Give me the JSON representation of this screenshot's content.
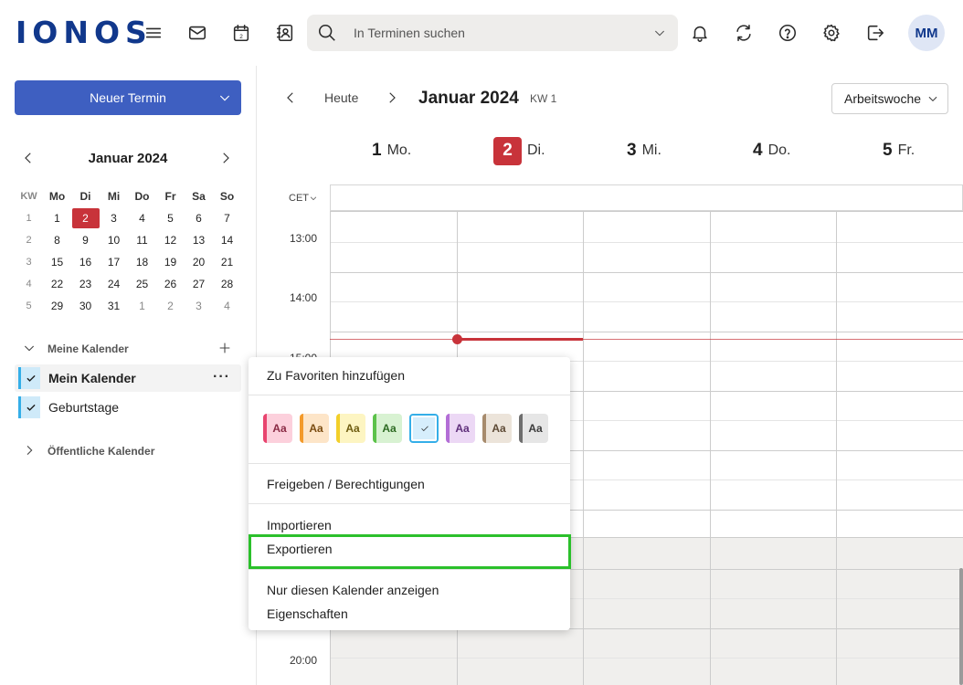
{
  "brand": {
    "logo_text": "IONOS",
    "color": "#11388c"
  },
  "topbar": {
    "icons": [
      "menu-icon",
      "mail-icon",
      "calendar-icon",
      "contacts-icon",
      "bell-icon",
      "refresh-icon",
      "help-icon",
      "settings-icon",
      "logout-icon"
    ],
    "calendar_icon_day": "2",
    "search": {
      "placeholder": "In Terminen suchen",
      "value": ""
    },
    "avatar_initials": "MM"
  },
  "sidebar": {
    "new_button_label": "Neuer Termin",
    "mini_calendar": {
      "title": "Januar 2024",
      "headers": [
        "KW",
        "Mo",
        "Di",
        "Mi",
        "Do",
        "Fr",
        "Sa",
        "So"
      ],
      "weeks": [
        {
          "kw": "1",
          "days": [
            {
              "d": "1"
            },
            {
              "d": "2",
              "today": true
            },
            {
              "d": "3"
            },
            {
              "d": "4"
            },
            {
              "d": "5"
            },
            {
              "d": "6"
            },
            {
              "d": "7"
            }
          ]
        },
        {
          "kw": "2",
          "days": [
            {
              "d": "8"
            },
            {
              "d": "9"
            },
            {
              "d": "10"
            },
            {
              "d": "11"
            },
            {
              "d": "12"
            },
            {
              "d": "13"
            },
            {
              "d": "14"
            }
          ]
        },
        {
          "kw": "3",
          "days": [
            {
              "d": "15"
            },
            {
              "d": "16"
            },
            {
              "d": "17"
            },
            {
              "d": "18"
            },
            {
              "d": "19"
            },
            {
              "d": "20"
            },
            {
              "d": "21"
            }
          ]
        },
        {
          "kw": "4",
          "days": [
            {
              "d": "22"
            },
            {
              "d": "23"
            },
            {
              "d": "24"
            },
            {
              "d": "25"
            },
            {
              "d": "26"
            },
            {
              "d": "27"
            },
            {
              "d": "28"
            }
          ]
        },
        {
          "kw": "5",
          "days": [
            {
              "d": "29"
            },
            {
              "d": "30"
            },
            {
              "d": "31"
            },
            {
              "d": "1",
              "other": true
            },
            {
              "d": "2",
              "other": true
            },
            {
              "d": "3",
              "other": true
            },
            {
              "d": "4",
              "other": true
            }
          ]
        }
      ]
    },
    "my_calendars_label": "Meine Kalender",
    "calendars": [
      {
        "label": "Mein Kalender",
        "active": true
      },
      {
        "label": "Geburtstage",
        "active": false
      }
    ],
    "public_calendars_label": "Öffentliche Kalender"
  },
  "main": {
    "today_label": "Heute",
    "month_title": "Januar 2024",
    "week_label": "KW 1",
    "view_label": "Arbeitswoche",
    "timezone_label": "CET",
    "days": [
      {
        "num": "1",
        "name": "Mo.",
        "today": false
      },
      {
        "num": "2",
        "name": "Di.",
        "today": true
      },
      {
        "num": "3",
        "name": "Mi.",
        "today": false
      },
      {
        "num": "4",
        "name": "Do.",
        "today": false
      },
      {
        "num": "5",
        "name": "Fr.",
        "today": false
      }
    ],
    "hours": [
      "13:00",
      "14:00",
      "15:00",
      "20:00"
    ],
    "accent_today": "#c8333a"
  },
  "context_menu": {
    "add_favorites": "Zu Favoriten hinzufügen",
    "swatch_text": "Aa",
    "swatches": [
      {
        "bg": "#fcd0dc",
        "border": "#e8456f",
        "fg": "#8a2a44"
      },
      {
        "bg": "#fde5c8",
        "border": "#f39a2b",
        "fg": "#7a4b10"
      },
      {
        "bg": "#fdf5c2",
        "border": "#f2cf2a",
        "fg": "#6e5c10"
      },
      {
        "bg": "#d8f2d2",
        "border": "#5cc24a",
        "fg": "#2d6a22"
      },
      {
        "bg": "#d6eefc",
        "border": "#34aee8",
        "fg": "#1f5d7a",
        "selected": true
      },
      {
        "bg": "#ecd8f5",
        "border": "#b36ed6",
        "fg": "#5e2e7a"
      },
      {
        "bg": "#ece4da",
        "border": "#a78b6d",
        "fg": "#5e4a35"
      },
      {
        "bg": "#e6e6e6",
        "border": "#6e6e6e",
        "fg": "#3b3b3b"
      }
    ],
    "share": "Freigeben / Berechtigungen",
    "import": "Importieren",
    "export": "Exportieren",
    "show_only": "Nur diesen Kalender anzeigen",
    "properties": "Eigenschaften",
    "highlight_color": "#2bc02b"
  }
}
